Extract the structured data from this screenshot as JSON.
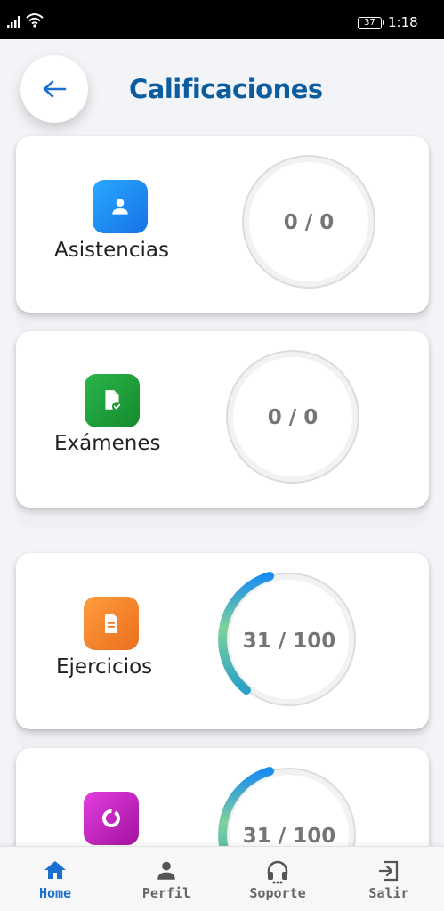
{
  "status_bar": {
    "battery": "37",
    "time": "1:18"
  },
  "header": {
    "title": "Calificaciones",
    "back_icon": "arrow-left-icon"
  },
  "colors": {
    "accent": "#0c5da0",
    "nav_active": "#1a6fd3"
  },
  "cards": [
    {
      "label": "Asistencias",
      "score": "0 / 0",
      "icon": "person-icon",
      "icon_color": "#1e88f0",
      "progress": 0
    },
    {
      "label": "Exámenes",
      "score": "0 / 0",
      "icon": "document-check-icon",
      "icon_color": "#1e9a3a",
      "progress": 0
    },
    {
      "label": "Ejercicios",
      "score": "31 / 100",
      "icon": "document-icon",
      "icon_color": "#f07f2a",
      "progress": 0.31
    },
    {
      "label": "",
      "score": "31 / 100",
      "icon": "donut-icon",
      "icon_color": "#c424c6",
      "progress": 0.31
    }
  ],
  "bottom_nav": [
    {
      "label": "Home",
      "icon": "home-icon",
      "active": true
    },
    {
      "label": "Perfil",
      "icon": "person-icon",
      "active": false
    },
    {
      "label": "Soporte",
      "icon": "headset-icon",
      "active": false
    },
    {
      "label": "Salir",
      "icon": "logout-icon",
      "active": false
    }
  ]
}
